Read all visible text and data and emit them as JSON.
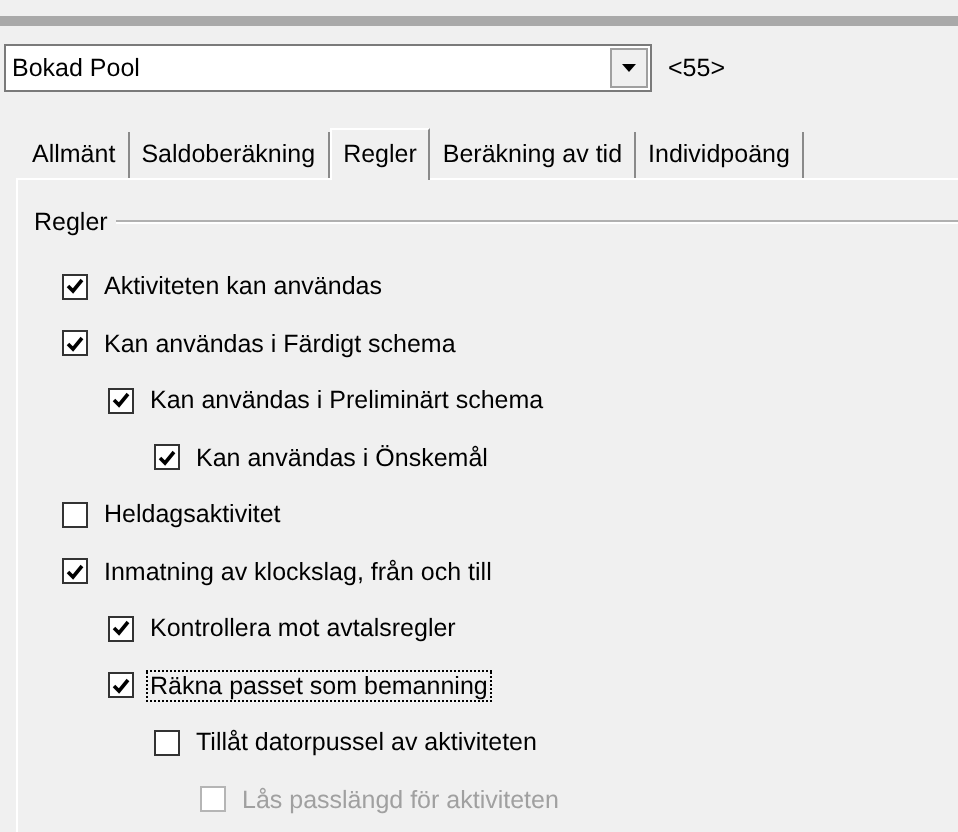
{
  "selector": {
    "value": "Bokad Pool",
    "code": "<55>"
  },
  "tabs": [
    {
      "label": "Allmänt",
      "selected": false
    },
    {
      "label": "Saldoberäkning",
      "selected": false
    },
    {
      "label": "Regler",
      "selected": true
    },
    {
      "label": "Beräkning av tid",
      "selected": false
    },
    {
      "label": "Individpoäng",
      "selected": false
    }
  ],
  "group": {
    "title": "Regler",
    "options": [
      {
        "label": "Aktiviteten kan användas",
        "checked": true
      },
      {
        "label": "Kan användas i Färdigt schema",
        "checked": true,
        "children": [
          {
            "label": "Kan användas i Preliminärt schema",
            "checked": true,
            "children": [
              {
                "label": "Kan användas i Önskemål",
                "checked": true
              }
            ]
          }
        ]
      },
      {
        "label": "Heldagsaktivitet",
        "checked": false
      },
      {
        "label": "Inmatning av klockslag, från och till",
        "checked": true,
        "children": [
          {
            "label": "Kontrollera mot avtalsregler",
            "checked": true
          },
          {
            "label": "Räkna passet som bemanning",
            "checked": true,
            "focused": true,
            "children": [
              {
                "label": "Tillåt datorpussel av aktiviteten",
                "checked": false,
                "children": [
                  {
                    "label": "Lås passlängd för aktiviteten",
                    "checked": false,
                    "disabled": true
                  }
                ]
              }
            ]
          }
        ]
      }
    ]
  }
}
